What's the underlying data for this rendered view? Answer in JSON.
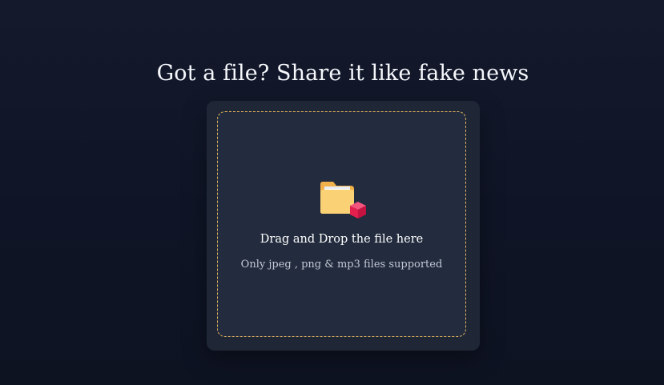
{
  "page": {
    "title": "Got a file? Share it like fake news"
  },
  "upload": {
    "icon": "folder-with-box-icon",
    "drop_label": "Drag and Drop the file here",
    "supported_note": "Only jpeg , png & mp3 files supported",
    "accent_color": "#e3b35c"
  }
}
